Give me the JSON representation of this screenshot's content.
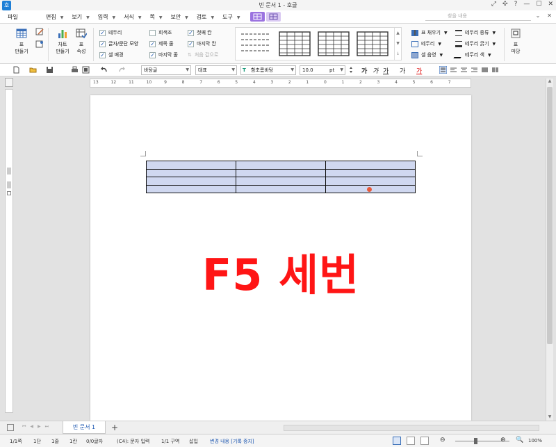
{
  "window": {
    "title": "빈 문서 1 - 호글",
    "app_icon_glyph": "호",
    "controls": [
      "⤢",
      "✣",
      "?",
      "—",
      "☐",
      "✕"
    ]
  },
  "menubar": {
    "file": "파일",
    "items": [
      "편집",
      "보기",
      "입력",
      "서식",
      "쪽",
      "보안",
      "검토",
      "도구"
    ],
    "search_placeholder": "찾을 내용",
    "right_controls": [
      "⌄",
      "✕"
    ]
  },
  "ribbon": {
    "table_create": "표\n만들기",
    "chart_create": "차트\n만들기",
    "table_props": "표\n속성",
    "checks": [
      {
        "label": "테두리",
        "checked": true
      },
      {
        "label": "글자/문단 모양",
        "checked": true
      },
      {
        "label": "셀 배경",
        "checked": true
      },
      {
        "label": "회색조",
        "checked": false
      },
      {
        "label": "제목 줄",
        "checked": true
      },
      {
        "label": "마지막 줄",
        "checked": true
      },
      {
        "label": "첫째 칸",
        "checked": true
      },
      {
        "label": "마지막 칸",
        "checked": true
      },
      {
        "label": "처음 값으로",
        "checked": false,
        "disabled": true
      }
    ],
    "cell_fill": "표 채우기",
    "border": "테두리",
    "cell_merge": "셀 음영",
    "border_type": "테두리 종류",
    "border_thickness": "테두리 굵기",
    "border_color": "테두리 색",
    "table_madang": "표\n마당"
  },
  "toolbar": {
    "style": "바탕글",
    "outline": "대표",
    "font": "함초롬바탕",
    "font_glyph": "T",
    "size": "10.0",
    "unit": "pt",
    "format_buttons": [
      "가",
      "가",
      "가",
      "가",
      "가"
    ]
  },
  "ruler": {
    "h_numbers": [
      "13",
      "12",
      "11",
      "10",
      "9",
      "8",
      "7",
      "6",
      "5",
      "4",
      "3",
      "2",
      "1",
      "0",
      "1",
      "2",
      "3",
      "4",
      "5",
      "6",
      "7"
    ]
  },
  "document": {
    "table_rows": 4,
    "table_cols": 3,
    "overlay_text": "F5 세번"
  },
  "tabs": {
    "doc_tab": "빈 문서 1",
    "add": "+"
  },
  "status": {
    "page": "1/1쪽",
    "section": "1단",
    "line": "1줄",
    "column": "1칸",
    "chars": "0/0글자",
    "cell": "(C4): 문자 입력",
    "area": "1/1 구역",
    "insert": "삽입",
    "track_changes": "변경 내용 [기록 중지]",
    "zoom": "100%"
  },
  "colors": {
    "accent_purple": "#9b73e0",
    "table_fill": "#d0d8f0",
    "overlay_red": "#ff1515"
  }
}
